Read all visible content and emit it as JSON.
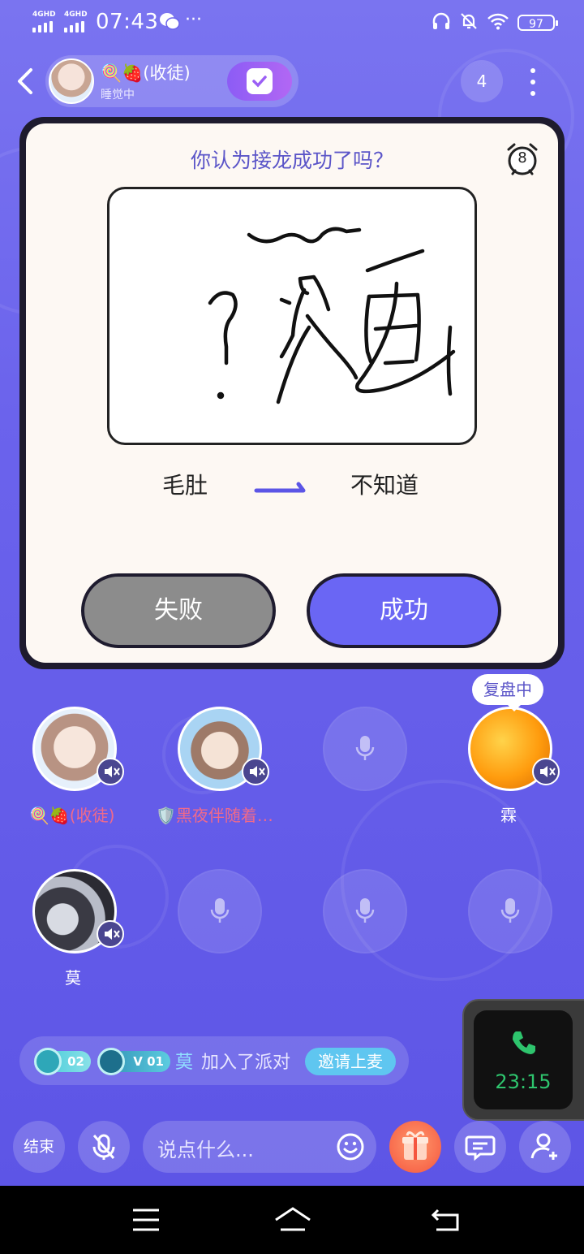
{
  "status_bar": {
    "signal1": "4GHD",
    "signal2": "4GHD",
    "time": "07:43",
    "more": "···",
    "battery": "97"
  },
  "header": {
    "room_name": "🍭🍓(收徒)",
    "room_status": "睡觉中",
    "online_count": "4"
  },
  "game_card": {
    "question": "你认为接龙成功了吗？",
    "timer": "8",
    "word_from": "毛肚",
    "word_to": "不知道",
    "fail_label": "失败",
    "success_label": "成功"
  },
  "seats": [
    {
      "name": "🍭🍓(收徒)",
      "occupied": true,
      "muted": true,
      "name_color": "#f06a8a"
    },
    {
      "name": "🛡️黑夜伴随着…",
      "occupied": true,
      "muted": true,
      "name_color": "#f06a8a"
    },
    {
      "name": "",
      "occupied": false
    },
    {
      "name": "霖",
      "occupied": true,
      "muted": true,
      "tag": "复盘中",
      "name_color": "#ffffff"
    },
    {
      "name": "莫",
      "occupied": true,
      "muted": true,
      "name_color": "#ffffff"
    },
    {
      "name": "",
      "occupied": false
    },
    {
      "name": "",
      "occupied": false
    },
    {
      "name": "",
      "occupied": false
    }
  ],
  "join_message": {
    "level1": "02",
    "level2": "V 01",
    "user": "莫",
    "text": "加入了派对",
    "invite_label": "邀请上麦"
  },
  "call": {
    "duration": "23:15"
  },
  "bottom_bar": {
    "end_label": "结束",
    "input_placeholder": "说点什么..."
  },
  "colors": {
    "accent": "#6a66f4",
    "background": "#6b63ec",
    "name_pink": "#f06a8a"
  }
}
